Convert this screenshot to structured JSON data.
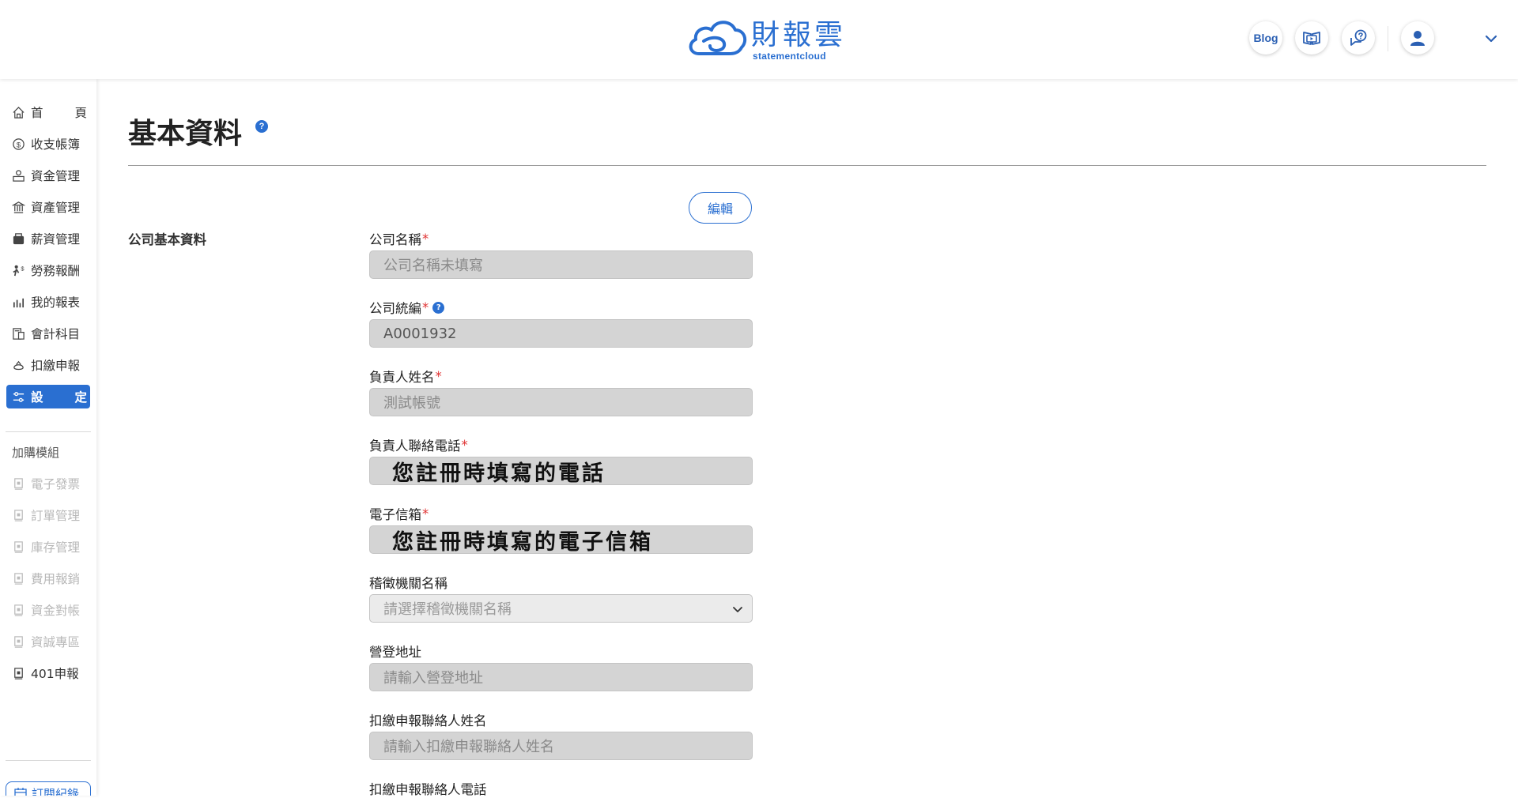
{
  "header": {
    "logo_zh": "財報雲",
    "logo_en": "statementcloud",
    "blog_label": "Blog"
  },
  "sidebar": {
    "items": [
      {
        "label_a": "首",
        "label_b": "頁"
      },
      {
        "label": "收支帳簿"
      },
      {
        "label": "資金管理"
      },
      {
        "label": "資產管理"
      },
      {
        "label": "薪資管理"
      },
      {
        "label": "勞務報酬"
      },
      {
        "label": "我的報表"
      },
      {
        "label": "會計科目"
      },
      {
        "label": "扣繳申報"
      },
      {
        "label_a": "設",
        "label_b": "定"
      }
    ],
    "addon_section": "加購模組",
    "addons": [
      {
        "label": "電子發票"
      },
      {
        "label": "訂單管理"
      },
      {
        "label": "庫存管理"
      },
      {
        "label": "費用報銷"
      },
      {
        "label": "資金對帳"
      },
      {
        "label": "資誠專區"
      },
      {
        "label": "401申報"
      }
    ],
    "subscription_label": "訂閱紀錄"
  },
  "main": {
    "page_title": "基本資料",
    "edit_label": "編輯",
    "section_label": "公司基本資料",
    "fields": [
      {
        "label": "公司名稱",
        "required": "*",
        "value": "公司名稱未填寫"
      },
      {
        "label": "公司統編",
        "required": "*",
        "value": "A0001932"
      },
      {
        "label": "負責人姓名",
        "required": "*",
        "value": "測試帳號"
      },
      {
        "label": "負責人聯絡電話",
        "required": "*",
        "value": "您註冊時填寫的電話"
      },
      {
        "label": "電子信箱",
        "required": "*",
        "value": "您註冊時填寫的電子信箱"
      },
      {
        "label": "稽徵機關名稱",
        "placeholder": "請選擇稽徵機關名稱"
      },
      {
        "label": "營登地址",
        "placeholder": "請輸入營登地址"
      },
      {
        "label": "扣繳申報聯絡人姓名",
        "placeholder": "請輸入扣繳申報聯絡人姓名"
      },
      {
        "label": "扣繳申報聯絡人電話"
      }
    ]
  },
  "colors": {
    "accent": "#2a6fd1",
    "required": "#e03333",
    "field_bg": "#d4d4d4"
  }
}
